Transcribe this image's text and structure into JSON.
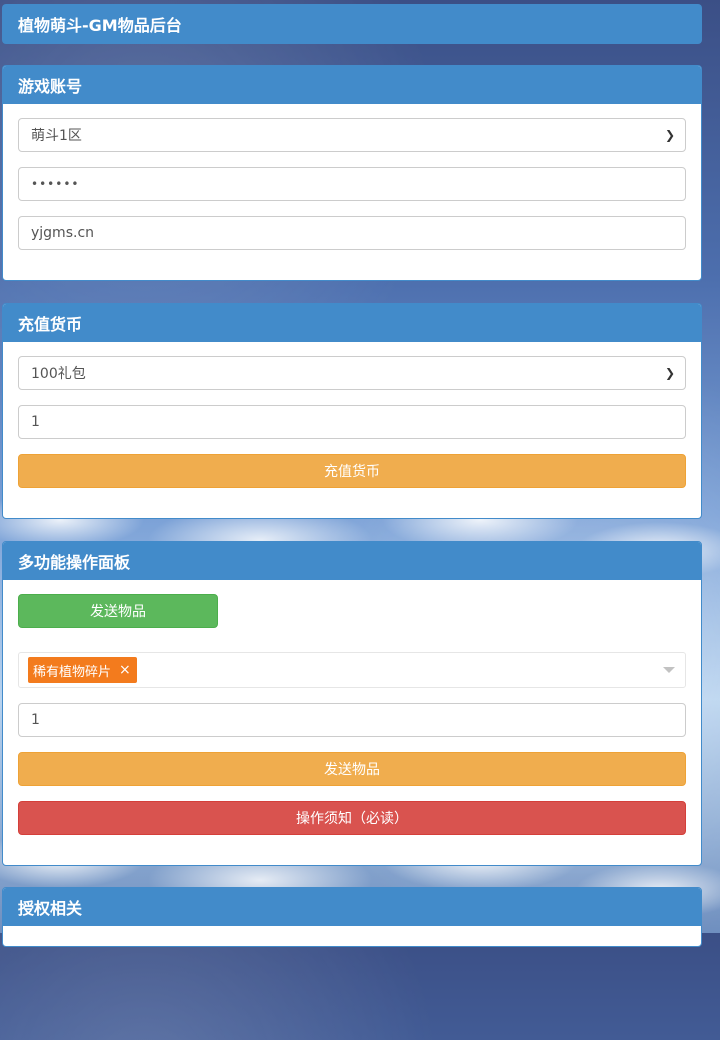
{
  "header": {
    "title": "植物萌斗-GM物品后台"
  },
  "account_panel": {
    "title": "游戏账号",
    "server_select": "萌斗1区",
    "password_value": "••••••",
    "account_value": "yjgms.cn"
  },
  "recharge_panel": {
    "title": "充值货币",
    "package_select": "100礼包",
    "quantity_value": "1",
    "submit_label": "充值货币"
  },
  "multi_panel": {
    "title": "多功能操作面板",
    "tab_send_label": "发送物品",
    "selected_item_tag": "稀有植物碎片",
    "tag_close_glyph": "×",
    "quantity_value": "1",
    "send_label": "发送物品",
    "notice_label": "操作须知（必读）"
  },
  "auth_panel": {
    "title": "授权相关"
  },
  "icons": {
    "chevron": "chevron-down-icon",
    "tag_close": "close-icon",
    "dropdown_arrow": "caret-down-icon"
  }
}
